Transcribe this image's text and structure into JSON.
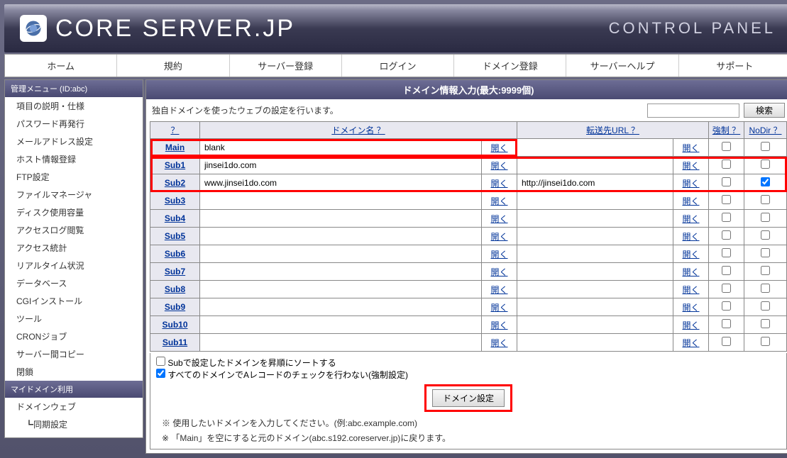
{
  "header": {
    "logo_text": "CORE SERVER.JP",
    "cp_text": "CONTROL PANEL"
  },
  "topnav": [
    "ホーム",
    "規約",
    "サーバー登録",
    "ログイン",
    "ドメイン登録",
    "サーバーヘルプ",
    "サポート"
  ],
  "sidebar": {
    "header1": "管理メニュー (ID:abc)",
    "items1": [
      "項目の説明・仕様",
      "パスワード再発行",
      "メールアドレス設定",
      "ホスト情報登録",
      "FTP設定",
      "ファイルマネージャ",
      "ディスク使用容量",
      "アクセスログ閲覧",
      "アクセス統計",
      "リアルタイム状況",
      "データベース",
      "CGIインストール",
      "ツール",
      "CRONジョブ",
      "サーバー間コピー",
      "閉鎖"
    ],
    "header2": "マイドメイン利用",
    "items2": [
      "ドメインウェブ",
      "　┗同期設定"
    ]
  },
  "content": {
    "title": "ドメイン情報入力(最大:9999個)",
    "description": "独自ドメインを使ったウェブの設定を行います。",
    "search_button": "検索",
    "headers": {
      "q": "？",
      "domain": "ドメイン名 ？",
      "url": "転送先URL ？",
      "force": "強制 ？",
      "nodir": "NoDir ？"
    },
    "open_label": "開く",
    "rows": [
      {
        "label": "Main",
        "domain": "blank",
        "url": "",
        "force": false,
        "nodir": false,
        "hl": "a"
      },
      {
        "label": "Sub1",
        "domain": "jinsei1do.com",
        "url": "",
        "force": false,
        "nodir": false,
        "hl": "b"
      },
      {
        "label": "Sub2",
        "domain": "www.jinsei1do.com",
        "url": "http://jinsei1do.com",
        "force": false,
        "nodir": true,
        "hl": "b"
      },
      {
        "label": "Sub3",
        "domain": "",
        "url": "",
        "force": false,
        "nodir": false
      },
      {
        "label": "Sub4",
        "domain": "",
        "url": "",
        "force": false,
        "nodir": false
      },
      {
        "label": "Sub5",
        "domain": "",
        "url": "",
        "force": false,
        "nodir": false
      },
      {
        "label": "Sub6",
        "domain": "",
        "url": "",
        "force": false,
        "nodir": false
      },
      {
        "label": "Sub7",
        "domain": "",
        "url": "",
        "force": false,
        "nodir": false
      },
      {
        "label": "Sub8",
        "domain": "",
        "url": "",
        "force": false,
        "nodir": false
      },
      {
        "label": "Sub9",
        "domain": "",
        "url": "",
        "force": false,
        "nodir": false
      },
      {
        "label": "Sub10",
        "domain": "",
        "url": "",
        "force": false,
        "nodir": false
      },
      {
        "label": "Sub11",
        "domain": "",
        "url": "",
        "force": false,
        "nodir": false
      }
    ],
    "opt1": "Subで設定したドメインを昇順にソートする",
    "opt1_checked": false,
    "opt2": "すべてのドメインでAレコードのチェックを行わない(強制設定)",
    "opt2_checked": true,
    "submit": "ドメイン設定",
    "note1": "※ 使用したいドメインを入力してください。(例:abc.example.com)",
    "note2": "※ 「Main」を空にすると元のドメイン(abc.s192.coreserver.jp)に戻ります。"
  }
}
